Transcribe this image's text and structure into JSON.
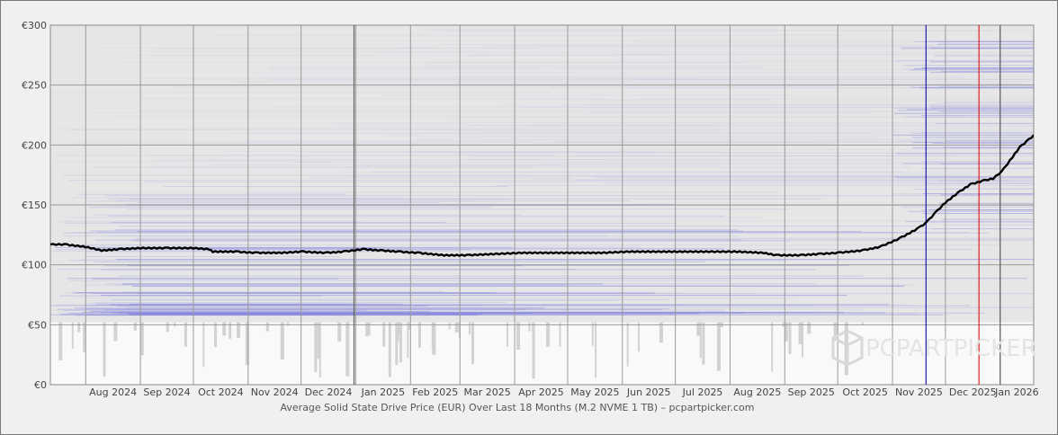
{
  "chart_data": {
    "type": "line",
    "title": "",
    "caption": "Average Solid State Drive Price (EUR) Over Last 18 Months (M.2 NVME 1 TB) – pcpartpicker.com",
    "ylim": [
      0,
      300
    ],
    "y_ticks": [
      {
        "value": 0,
        "label": "€0"
      },
      {
        "value": 50,
        "label": "€50"
      },
      {
        "value": 100,
        "label": "€100"
      },
      {
        "value": 150,
        "label": "€150"
      },
      {
        "value": 200,
        "label": "€200"
      },
      {
        "value": 250,
        "label": "€250"
      },
      {
        "value": 300,
        "label": "€300"
      }
    ],
    "x_range": [
      "2024-07-12",
      "2026-01-20"
    ],
    "x_ticks": [
      "Aug 2024",
      "Sep 2024",
      "Oct 2024",
      "Nov 2024",
      "Dec 2024",
      "Jan 2025",
      "Feb 2025",
      "Mar 2025",
      "Apr 2025",
      "May 2025",
      "Jun 2025",
      "Jul 2025",
      "Aug 2025",
      "Sep 2025",
      "Oct 2025",
      "Nov 2025",
      "Dec 2025",
      "Jan 2026"
    ],
    "grid": true,
    "series": [
      {
        "color": "#000000",
        "points": [
          [
            "2024-07-12",
            117
          ],
          [
            "2024-07-20",
            117
          ],
          [
            "2024-08-01",
            115
          ],
          [
            "2024-08-10",
            112
          ],
          [
            "2024-08-20",
            113
          ],
          [
            "2024-09-01",
            114
          ],
          [
            "2024-09-15",
            114
          ],
          [
            "2024-10-01",
            114
          ],
          [
            "2024-10-10",
            113
          ],
          [
            "2024-10-12",
            111
          ],
          [
            "2024-10-25",
            111
          ],
          [
            "2024-11-05",
            110
          ],
          [
            "2024-11-20",
            110
          ],
          [
            "2024-12-01",
            111
          ],
          [
            "2024-12-15",
            110
          ],
          [
            "2024-12-25",
            111
          ],
          [
            "2025-01-05",
            113
          ],
          [
            "2025-01-15",
            112
          ],
          [
            "2025-01-25",
            111
          ],
          [
            "2025-02-05",
            110
          ],
          [
            "2025-02-20",
            108
          ],
          [
            "2025-03-05",
            108
          ],
          [
            "2025-03-20",
            109
          ],
          [
            "2025-04-05",
            110
          ],
          [
            "2025-04-20",
            110
          ],
          [
            "2025-05-05",
            110
          ],
          [
            "2025-05-20",
            110
          ],
          [
            "2025-06-05",
            111
          ],
          [
            "2025-06-20",
            111
          ],
          [
            "2025-07-05",
            111
          ],
          [
            "2025-07-20",
            111
          ],
          [
            "2025-08-05",
            111
          ],
          [
            "2025-08-20",
            110
          ],
          [
            "2025-08-27",
            108
          ],
          [
            "2025-09-10",
            108
          ],
          [
            "2025-09-20",
            109
          ],
          [
            "2025-10-01",
            110
          ],
          [
            "2025-10-15",
            112
          ],
          [
            "2025-10-25",
            115
          ],
          [
            "2025-11-05",
            122
          ],
          [
            "2025-11-15",
            130
          ],
          [
            "2025-11-20",
            135
          ],
          [
            "2025-11-25",
            143
          ],
          [
            "2025-12-01",
            152
          ],
          [
            "2025-12-08",
            160
          ],
          [
            "2025-12-15",
            167
          ],
          [
            "2025-12-22",
            170
          ],
          [
            "2025-12-28",
            172
          ],
          [
            "2026-01-02",
            178
          ],
          [
            "2026-01-08",
            190
          ],
          [
            "2026-01-12",
            198
          ],
          [
            "2026-01-16",
            203
          ],
          [
            "2026-01-20",
            208
          ]
        ]
      }
    ],
    "markers": [
      {
        "date": "2024-12-31",
        "color": "#606060"
      },
      {
        "date": "2025-11-20",
        "color": "#1c1cb0"
      },
      {
        "date": "2025-12-20",
        "color": "#e02020"
      },
      {
        "date": "2026-01-01",
        "color": "#606060"
      }
    ],
    "watermark": "PCPARTPICKER",
    "colors": {
      "plot_bg": "#e6e6e6",
      "lower_bg": "#f9f9f9",
      "grid": "#9a9a9a",
      "band": "#4b4bdd"
    }
  }
}
